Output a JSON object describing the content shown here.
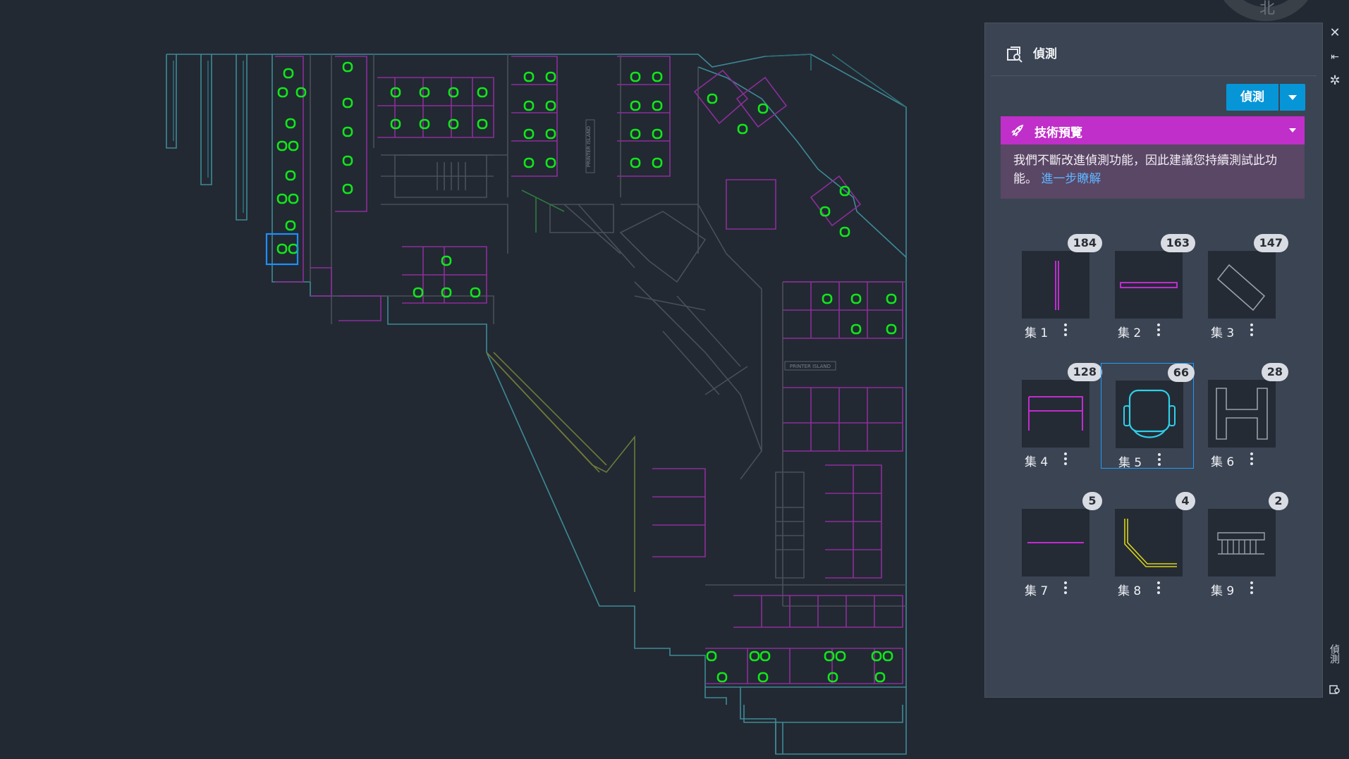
{
  "palette": {
    "title": "偵測",
    "detect_button": "偵測",
    "tech_preview": {
      "title": "技術預覽",
      "message": "我們不斷改進偵測功能，因此建議您持續測試此功能。",
      "link": "進一步瞭解"
    },
    "sets": [
      {
        "name": "集 1",
        "count": "184",
        "icon": "vertical-line"
      },
      {
        "name": "集 2",
        "count": "163",
        "icon": "horizontal-bar"
      },
      {
        "name": "集 3",
        "count": "147",
        "icon": "rotated-rectangle"
      },
      {
        "name": "集 4",
        "count": "128",
        "icon": "table-frame"
      },
      {
        "name": "集 5",
        "count": "66",
        "icon": "chair",
        "selected": true
      },
      {
        "name": "集 6",
        "count": "28",
        "icon": "h-shape"
      },
      {
        "name": "集 7",
        "count": "5",
        "icon": "short-line"
      },
      {
        "name": "集 8",
        "count": "4",
        "icon": "corner-line"
      },
      {
        "name": "集 9",
        "count": "2",
        "icon": "stair-rail"
      }
    ],
    "side_label": "偵測"
  },
  "drawing": {
    "compass_label": "北",
    "printer_labels": [
      "PRINTER ISLAND",
      "PRINTER ISLAND"
    ]
  },
  "colors": {
    "background": "#222933",
    "accent": "#0696d7",
    "preview": "#c02fc9",
    "detected": "#12e61a",
    "wall": "#3e8a95",
    "room": "#8d2d9a"
  }
}
